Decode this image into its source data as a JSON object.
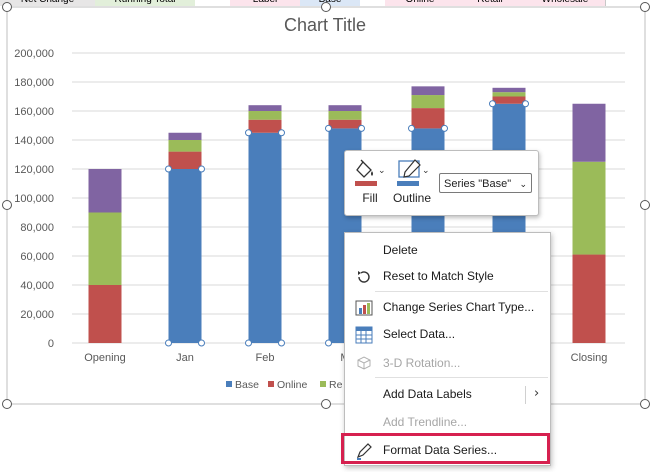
{
  "sheet_header": {
    "cells": [
      "Net Change",
      "Running Total",
      "",
      "Label",
      "Base",
      "",
      "Online",
      "Retail",
      "Wholesale"
    ]
  },
  "chart": {
    "title": "Chart Title",
    "legend": [
      "Base",
      "Online",
      "Re"
    ]
  },
  "chart_data": {
    "type": "bar",
    "title": "Chart Title",
    "categories": [
      "Opening",
      "Jan",
      "Feb",
      "M",
      "",
      "",
      "",
      "Closing"
    ],
    "ylim": [
      0,
      200000
    ],
    "yticks": [
      "0",
      "20,000",
      "40,000",
      "60,000",
      "80,000",
      "100,000",
      "120,000",
      "140,000",
      "160,000",
      "180,000",
      "200,000"
    ],
    "stacked": true,
    "series": [
      {
        "name": "Base",
        "color": "#4a7ebb",
        "values": [
          0,
          120000,
          145000,
          148000,
          148000,
          165000,
          0,
          0
        ]
      },
      {
        "name": "Online",
        "color": "#c0504d",
        "values": [
          40000,
          12000,
          9000,
          6000,
          14000,
          5000,
          0,
          61000
        ]
      },
      {
        "name": "Re",
        "color": "#9bbb59",
        "values": [
          50000,
          8000,
          6000,
          6000,
          9000,
          3000,
          0,
          64000
        ]
      },
      {
        "name": "",
        "color": "#8064a2",
        "values": [
          30000,
          5000,
          4000,
          4000,
          6000,
          3000,
          0,
          40000
        ]
      }
    ],
    "grid": true,
    "legend_position": "bottom"
  },
  "toolbar": {
    "fill_label": "Fill",
    "outline_label": "Outline",
    "series_select_value": "Series \"Base\""
  },
  "context_menu": {
    "items": [
      {
        "label": "Delete",
        "icon": "none",
        "enabled": true
      },
      {
        "label": "Reset to Match Style",
        "icon": "reset-icon",
        "enabled": true
      },
      {
        "label": "Change Series Chart Type...",
        "icon": "chart-type-icon",
        "enabled": true
      },
      {
        "label": "Select Data...",
        "icon": "select-data-icon",
        "enabled": true
      },
      {
        "label": "3-D Rotation...",
        "icon": "rotation-icon",
        "enabled": false
      },
      {
        "label": "Add Data Labels",
        "icon": "none",
        "enabled": true,
        "submenu": true
      },
      {
        "label": "Add Trendline...",
        "icon": "none",
        "enabled": false
      },
      {
        "label": "Format Data Series...",
        "icon": "format-series-icon",
        "enabled": true
      }
    ]
  },
  "colors": {
    "highlight": "#d6204f",
    "base": "#4a7ebb",
    "online": "#c0504d",
    "retail": "#9bbb59",
    "wholesale": "#8064a2"
  }
}
